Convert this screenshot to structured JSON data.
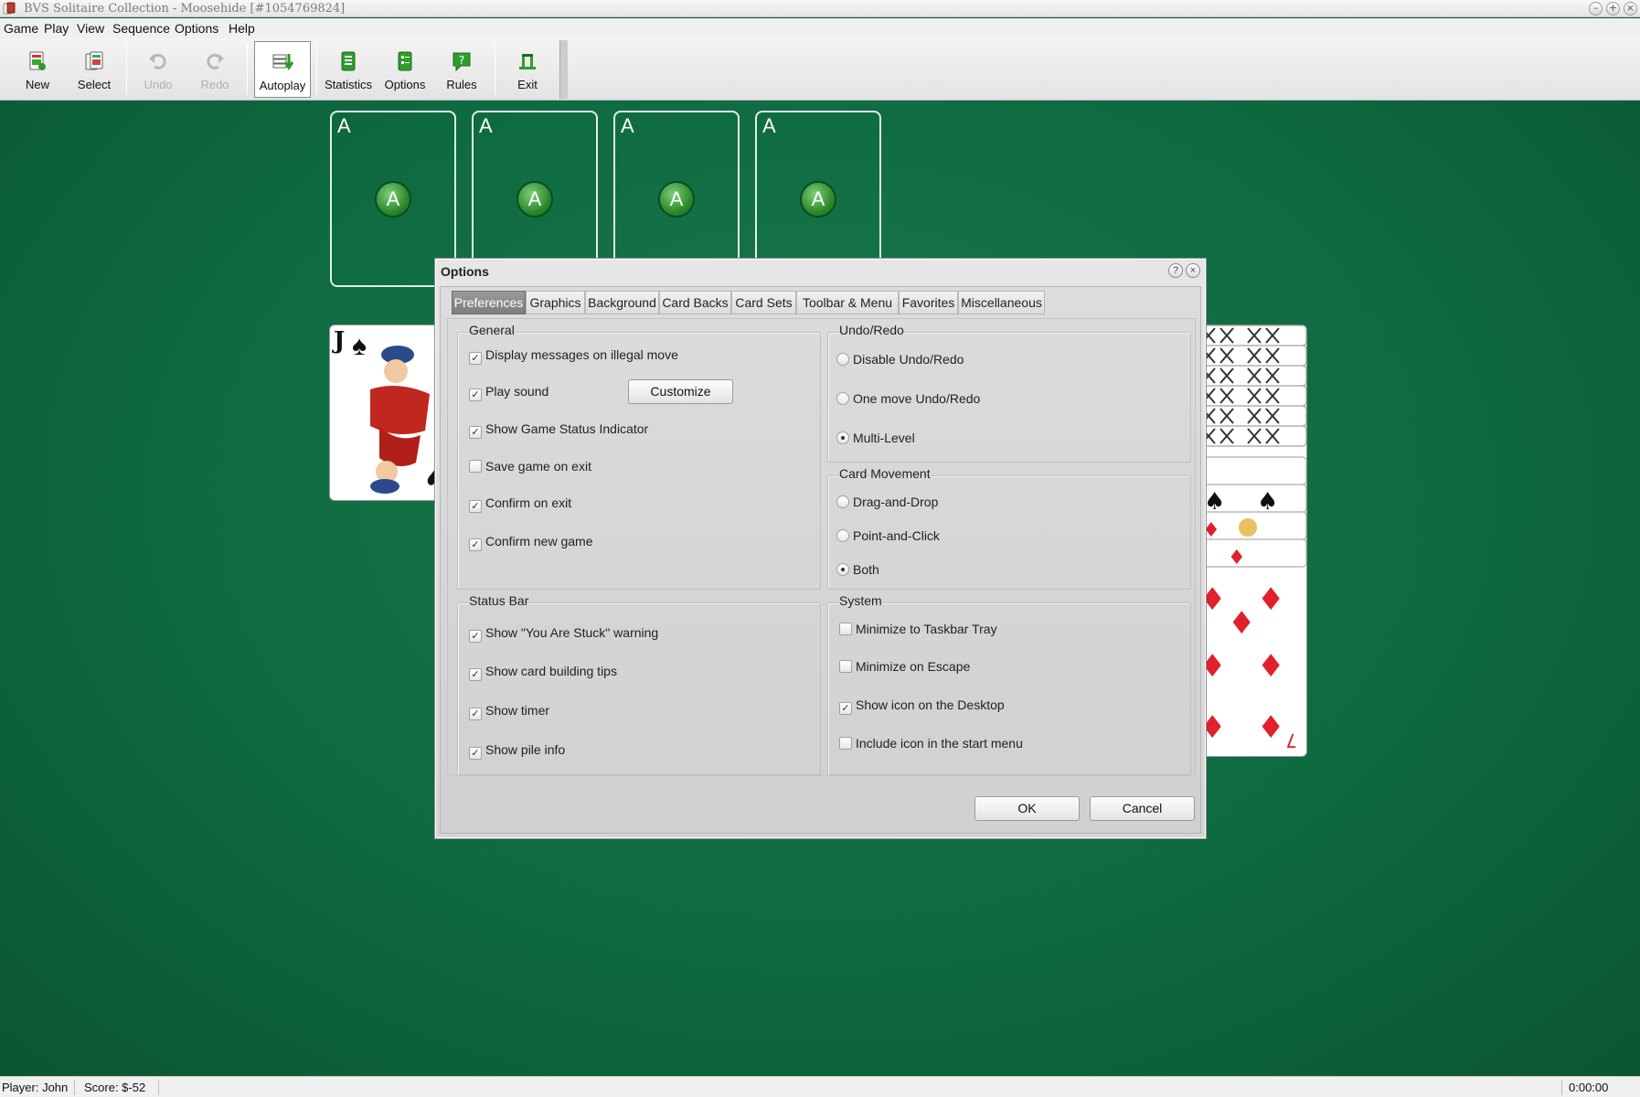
{
  "window": {
    "title": "BVS Solitaire Collection  -  Moosehide [#1054769824]"
  },
  "menu": [
    "Game",
    "Play",
    "View",
    "Sequence",
    "Options",
    "Help"
  ],
  "toolbar": {
    "new": "New",
    "select": "Select",
    "undo": "Undo",
    "redo": "Redo",
    "autoplay": "Autoplay",
    "statistics": "Statistics",
    "options": "Options",
    "rules": "Rules",
    "exit": "Exit"
  },
  "foundations": [
    {
      "corner": "A",
      "badge": "A"
    },
    {
      "corner": "A",
      "badge": "A"
    },
    {
      "corner": "A",
      "badge": "A"
    },
    {
      "corner": "A",
      "badge": "A"
    }
  ],
  "tableau_card": {
    "rank": "J",
    "suit": "♠"
  },
  "dialog": {
    "title": "Options",
    "help_icon": "?",
    "close_icon": "×",
    "tabs": [
      "Preferences",
      "Graphics",
      "Background",
      "Card Backs",
      "Card Sets",
      "Toolbar & Menu",
      "Favorites",
      "Miscellaneous"
    ],
    "active_tab": "Preferences",
    "general": {
      "title": "General",
      "items": [
        {
          "label": "Display messages on illegal move",
          "checked": true
        },
        {
          "label": "Play sound",
          "checked": true
        },
        {
          "label": "Show Game Status Indicator",
          "checked": true
        },
        {
          "label": "Save game on exit",
          "checked": false
        },
        {
          "label": "Confirm on exit",
          "checked": true
        },
        {
          "label": "Confirm new game",
          "checked": true
        }
      ],
      "customize_button": "Customize"
    },
    "undo_redo": {
      "title": "Undo/Redo",
      "items": [
        {
          "label": "Disable Undo/Redo",
          "selected": false
        },
        {
          "label": "One move Undo/Redo",
          "selected": false
        },
        {
          "label": "Multi-Level",
          "selected": true
        }
      ]
    },
    "card_movement": {
      "title": "Card Movement",
      "items": [
        {
          "label": "Drag-and-Drop",
          "selected": false
        },
        {
          "label": "Point-and-Click",
          "selected": false
        },
        {
          "label": "Both",
          "selected": true
        }
      ]
    },
    "status_bar": {
      "title": "Status Bar",
      "items": [
        {
          "label": "Show \"You Are Stuck\" warning",
          "checked": true
        },
        {
          "label": "Show card building tips",
          "checked": true
        },
        {
          "label": "Show timer",
          "checked": true
        },
        {
          "label": "Show pile info",
          "checked": true
        }
      ]
    },
    "system": {
      "title": "System",
      "items": [
        {
          "label": "Minimize to Taskbar Tray",
          "checked": false
        },
        {
          "label": "Minimize on Escape",
          "checked": false
        },
        {
          "label": "Show icon on the Desktop",
          "checked": true
        },
        {
          "label": "Include icon in the start menu",
          "checked": false
        }
      ]
    },
    "ok_button": "OK",
    "cancel_button": "Cancel"
  },
  "status": {
    "player": "Player: John",
    "score": "Score: $-52",
    "timer": "0:00:00"
  },
  "colors": {
    "felt": "#0e6a40",
    "active_tab": "#8a8a8a",
    "ace_badge": "#2d8b2c",
    "diamond_red": "#e0202a"
  }
}
